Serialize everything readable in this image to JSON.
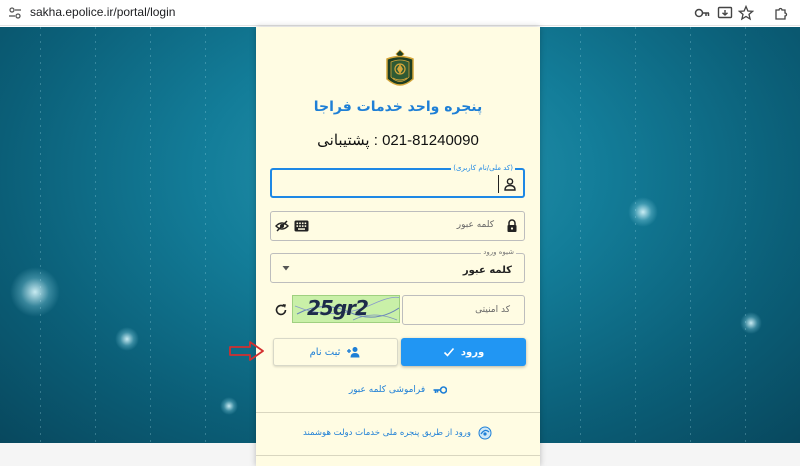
{
  "browser": {
    "url": "sakha.epolice.ir/portal/login"
  },
  "portal": {
    "title": "پنجره واحد خدمات فراجا",
    "support": "021-81240090 : پشتیبانی"
  },
  "form": {
    "username_label": "(کد ملی/نام کاربری)",
    "username_value": "",
    "password_placeholder": "کلمه عبور",
    "login_method_label": "شیوه ورود",
    "login_method_value": "کلمه عبور",
    "captcha_text": "25gr2",
    "captcha_placeholder": "کد امنیتی"
  },
  "buttons": {
    "login": "ورود",
    "register": "ثبت نام"
  },
  "links": {
    "forgot_password": "فراموشی کلمه عبور",
    "smart_gov": "ورود از طریق پنجره ملی خدمات دولت هوشمند"
  },
  "colors": {
    "accent": "#2196f3",
    "card": "#fffce3",
    "arrow": "#d32f2f"
  }
}
